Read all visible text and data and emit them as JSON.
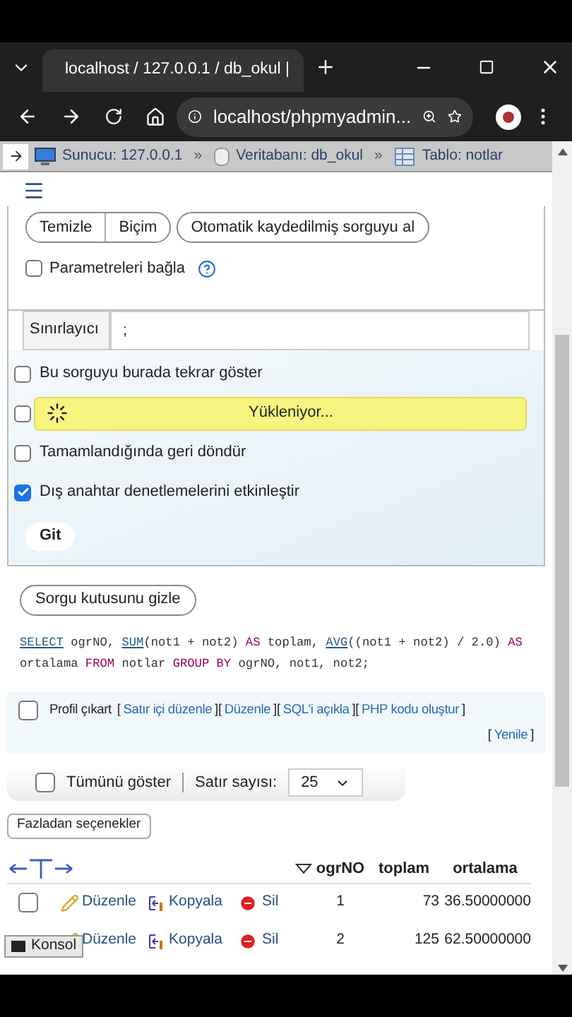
{
  "browser": {
    "tab_title": "localhost / 127.0.0.1 / db_okul |",
    "url": "localhost/phpmyadmin..."
  },
  "breadcrumb": [
    {
      "kind": "server",
      "label": "Sunucu: 127.0.0.1",
      "sep": "»"
    },
    {
      "kind": "database",
      "label": "Veritabanı: db_okul",
      "sep": "»"
    },
    {
      "kind": "table",
      "label": "Tablo: notlar"
    }
  ],
  "query_buttons": [
    "Temizle",
    "Biçim"
  ],
  "autosave_button": "Otomatik kaydedilmiş sorguyu al",
  "bind_params": {
    "label": "Parametreleri bağla",
    "checked": false
  },
  "delimiter": {
    "label": "Sınırlayıcı",
    "value": ";"
  },
  "options": [
    {
      "label": "Bu sorguyu burada tekrar göster",
      "checked": false
    },
    {
      "checked": false
    },
    {
      "label": "Tamamlandığında geri döndür",
      "checked": false
    },
    {
      "label": "Dış anahtar denetlemelerini etkinleştir",
      "checked": true
    }
  ],
  "loading": {
    "text": "Yükleniyor..."
  },
  "submit": "Git",
  "toggle_button": "Sorgu kutusunu gizle",
  "sql": [
    {
      "kind": "function",
      "text": "SELECT"
    },
    {
      "kind": "plain",
      "text": " ogrNO, "
    },
    {
      "kind": "function",
      "text": "SUM"
    },
    {
      "kind": "plain",
      "text": "(not1 + not2) "
    },
    {
      "kind": "keyword",
      "text": "AS"
    },
    {
      "kind": "plain",
      "text": " toplam, "
    },
    {
      "kind": "function",
      "text": "AVG"
    },
    {
      "kind": "plain",
      "text": "((not1 + not2) / 2.0) "
    },
    {
      "kind": "keyword",
      "text": "AS"
    },
    {
      "kind": "plain",
      "text": " ortalama "
    },
    {
      "kind": "keyword",
      "text": "FROM"
    },
    {
      "kind": "plain",
      "text": " notlar "
    },
    {
      "kind": "keyword",
      "text": "GROUP BY"
    },
    {
      "kind": "plain",
      "text": " ogrNO, not1, not2;"
    }
  ],
  "profile": {
    "label": "Profil çıkart",
    "checked": false,
    "links": [
      {
        "open": "[",
        "label": "Satır içi düzenle",
        "close": "]"
      },
      {
        "open": "[",
        "label": "Düzenle",
        "close": "]"
      },
      {
        "open": "[",
        "label": "SQL'i açıkla",
        "close": "]"
      },
      {
        "open": "[",
        "label": "PHP kodu oluştur",
        "close": "]"
      },
      {
        "open": "[",
        "label": "Yenile",
        "close": "]"
      }
    ]
  },
  "show_all": {
    "label": "Tümünü göster",
    "checked": false
  },
  "rows_count": {
    "label": "Satır sayısı:",
    "value": "25"
  },
  "extra_options": "Fazladan seçenekler",
  "table": {
    "columns": [
      "ogrNO",
      "toplam",
      "ortalama"
    ],
    "rows": [
      {
        "checked": false,
        "actions": [
          "Düzenle",
          "Kopyala",
          "Sil"
        ],
        "cells": [
          "1",
          "73",
          "36.50000000"
        ]
      },
      {
        "actions": [
          "Düzenle",
          "Kopyala",
          "Sil"
        ],
        "cells": [
          "2",
          "125",
          "62.50000000"
        ]
      }
    ]
  },
  "console": "Konsol"
}
